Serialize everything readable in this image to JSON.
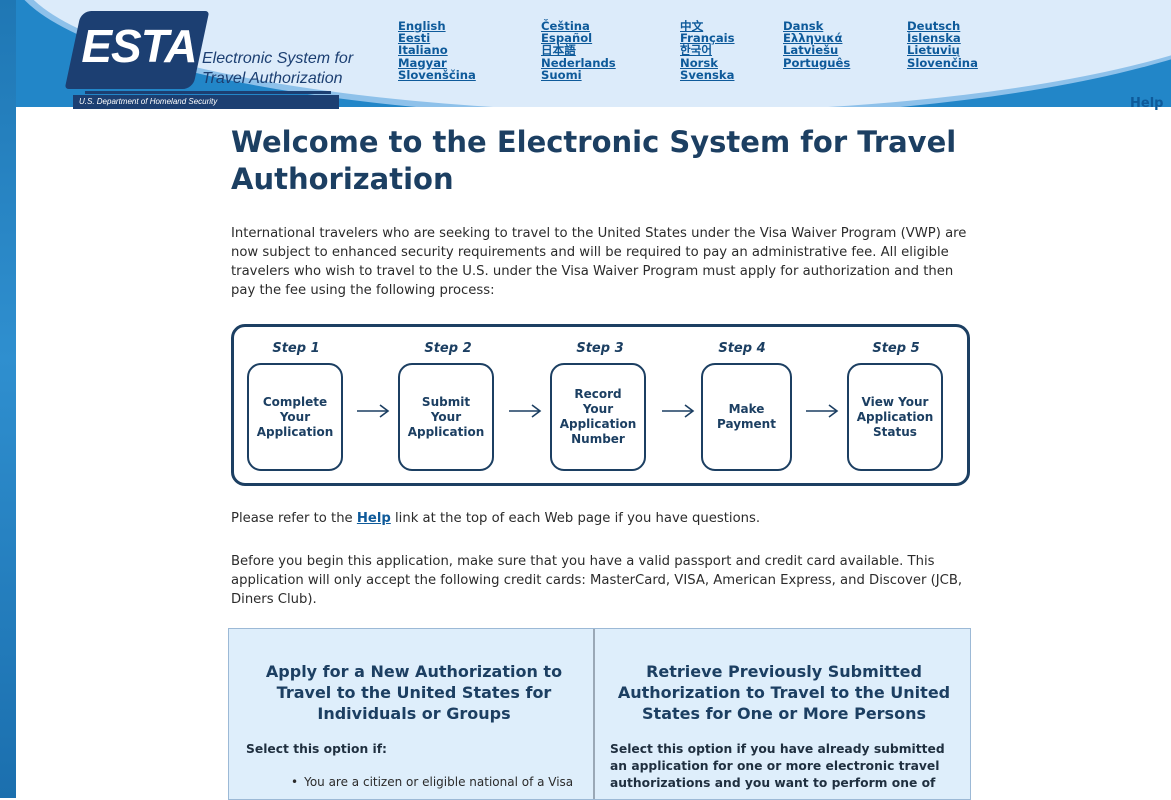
{
  "header": {
    "logo": {
      "badge_text": "ESTA",
      "name_line1": "Electronic System for",
      "name_line2": "Travel Authorization",
      "department": "U.S. Department of Homeland Security"
    },
    "languages": [
      [
        "English",
        "Eesti",
        "Italiano",
        "Magyar",
        "Slovenščina"
      ],
      [
        "Čeština",
        "Español",
        "日本語",
        "Nederlands",
        "Suomi"
      ],
      [
        "中文",
        "Français",
        "한국어",
        "Norsk",
        "Svenska"
      ],
      [
        "Dansk",
        "Ελληνικά",
        "Latviešu",
        "Português"
      ],
      [
        "Deutsch",
        "Íslenska",
        "Lietuvių",
        "Slovenčina"
      ]
    ],
    "help_label": "Help"
  },
  "main": {
    "title": "Welcome to the Electronic System for Travel Authorization",
    "intro": "International travelers who are seeking to travel to the United States under the Visa Waiver Program (VWP) are now subject to enhanced security requirements and will be required to pay an administrative fee. All eligible travelers who wish to travel to the U.S. under the Visa Waiver Program must apply for authorization and then pay the fee using the following process:",
    "help_note_before": "Please refer to the ",
    "help_note_link": "Help",
    "help_note_after": " link at the top of each Web page if you have questions.",
    "cards_note": "Before you begin this application, make sure that you have a valid passport and credit card available. This application will only accept the following credit cards: MasterCard, VISA, American Express, and Discover (JCB, Diners Club)."
  },
  "steps": [
    {
      "label": "Step 1",
      "lines": [
        "Complete",
        "Your",
        "Application"
      ]
    },
    {
      "label": "Step 2",
      "lines": [
        "Submit",
        "Your",
        "Application"
      ]
    },
    {
      "label": "Step 3",
      "lines": [
        "Record",
        "Your",
        "Application",
        "Number"
      ]
    },
    {
      "label": "Step 4",
      "lines": [
        "Make",
        "Payment"
      ]
    },
    {
      "label": "Step 5",
      "lines": [
        "View Your",
        "Application",
        "Status"
      ]
    }
  ],
  "options": {
    "new": {
      "title": "Apply for a New Authorization to Travel to the United States for Individuals or Groups",
      "subtitle": "Select this option if:",
      "bullet": "You are a citizen or eligible national of a Visa"
    },
    "retrieve": {
      "title": "Retrieve Previously Submitted Authorization to Travel to the United States for One or More Persons",
      "subtitle": "Select this option if you have already submitted an application for one or more electronic travel authorizations and you want to perform one of"
    }
  },
  "colors": {
    "frame_blue": "#2286c8",
    "header_bg": "#dcebfa",
    "navy": "#1c3f62",
    "link": "#0e5a9a",
    "panel_bg": "#deeefb"
  }
}
